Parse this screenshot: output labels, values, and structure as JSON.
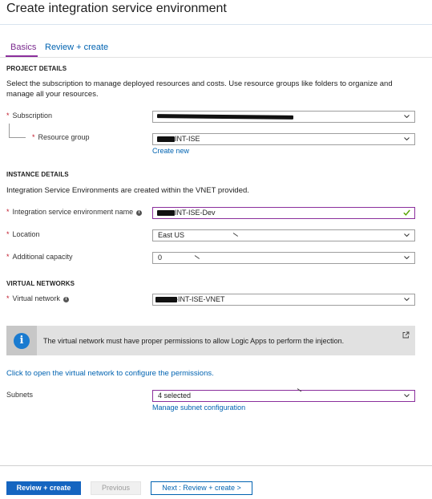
{
  "page": {
    "title": "Create integration service environment"
  },
  "tabs": [
    {
      "label": "Basics",
      "active": true
    },
    {
      "label": "Review + create",
      "active": false
    }
  ],
  "project_details": {
    "heading": "PROJECT DETAILS",
    "description": "Select the subscription to manage deployed resources and costs. Use resource groups like folders to organize and manage all your resources.",
    "subscription": {
      "label": "Subscription",
      "value": ""
    },
    "resource_group": {
      "label": "Resource group",
      "value": "-INT-ISE",
      "create_new": "Create new"
    }
  },
  "instance_details": {
    "heading": "INSTANCE DETAILS",
    "description": "Integration Service Environments are created within the VNET provided.",
    "ise_name": {
      "label": "Integration service environment name",
      "value": "-INT-ISE-Dev"
    },
    "location": {
      "label": "Location",
      "value": "East US"
    },
    "capacity": {
      "label": "Additional capacity",
      "value": "0"
    }
  },
  "virtual_networks": {
    "heading": "VIRTUAL NETWORKS",
    "vnet": {
      "label": "Virtual network",
      "value": "-INT-ISE-VNET"
    }
  },
  "banner": {
    "text": "The virtual network must have proper permissions to allow Logic Apps to perform the injection.",
    "icon": "info-icon"
  },
  "permissions_link": "Click to open the virtual network to configure the permissions.",
  "subnets": {
    "label": "Subnets",
    "value": "4 selected",
    "manage": "Manage subnet configuration"
  },
  "footer": {
    "review_create": "Review + create",
    "previous": "Previous",
    "next": "Next : Review + create >"
  },
  "colors": {
    "accent": "#8b2f9c",
    "link": "#0063b1",
    "primary_button": "#1565c0",
    "required": "#c0182a",
    "valid_check": "#57a300",
    "info_blue": "#1a7bd0"
  },
  "icon_font_glyphs": {
    "info_symbol": "i"
  }
}
